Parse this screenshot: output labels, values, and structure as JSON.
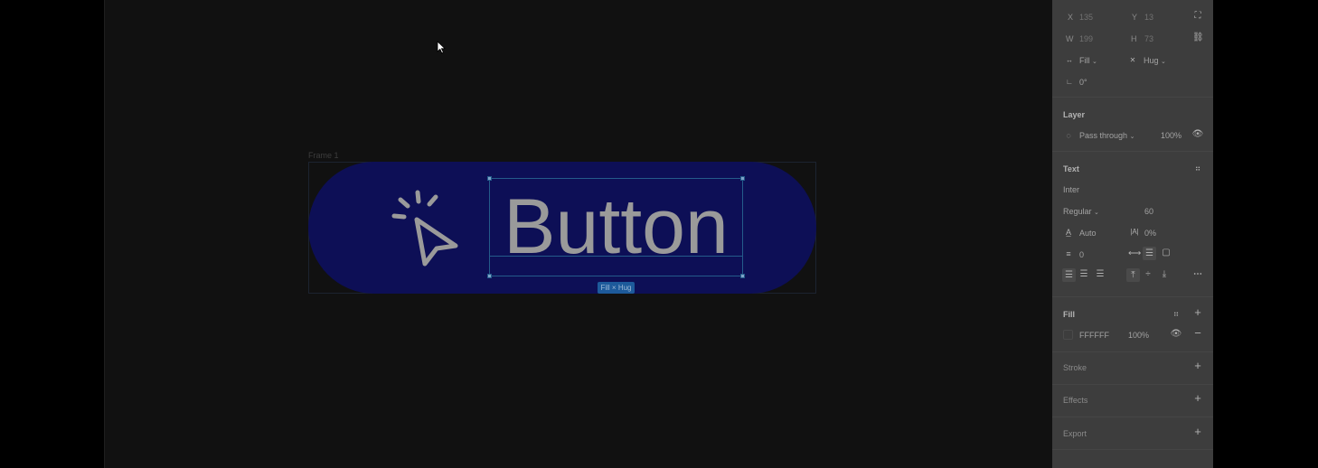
{
  "canvas": {
    "frame_label": "Frame 1",
    "button_text": "Button",
    "size_badge": "Fill × Hug"
  },
  "inspector": {
    "x_label": "X",
    "x_value": "135",
    "y_label": "Y",
    "y_value": "13",
    "w_label": "W",
    "w_value": "199",
    "h_label": "H",
    "h_value": "73",
    "horizontal_resizing": "Fill",
    "vertical_resizing": "Hug",
    "rotation": "0°",
    "layer": {
      "title": "Layer",
      "blend_mode": "Pass through",
      "opacity": "100%"
    },
    "text": {
      "title": "Text",
      "font_family": "Inter",
      "font_weight": "Regular",
      "font_size": "60",
      "line_height": "Auto",
      "letter_spacing": "0%",
      "paragraph_spacing": "0"
    },
    "fill": {
      "title": "Fill",
      "hex": "FFFFFF",
      "opacity": "100%"
    },
    "stroke_title": "Stroke",
    "effects_title": "Effects",
    "export_title": "Export"
  },
  "colors": {
    "button_bg": "#0d0f56",
    "selection": "#245b8a",
    "badge": "#1d5a9b"
  }
}
